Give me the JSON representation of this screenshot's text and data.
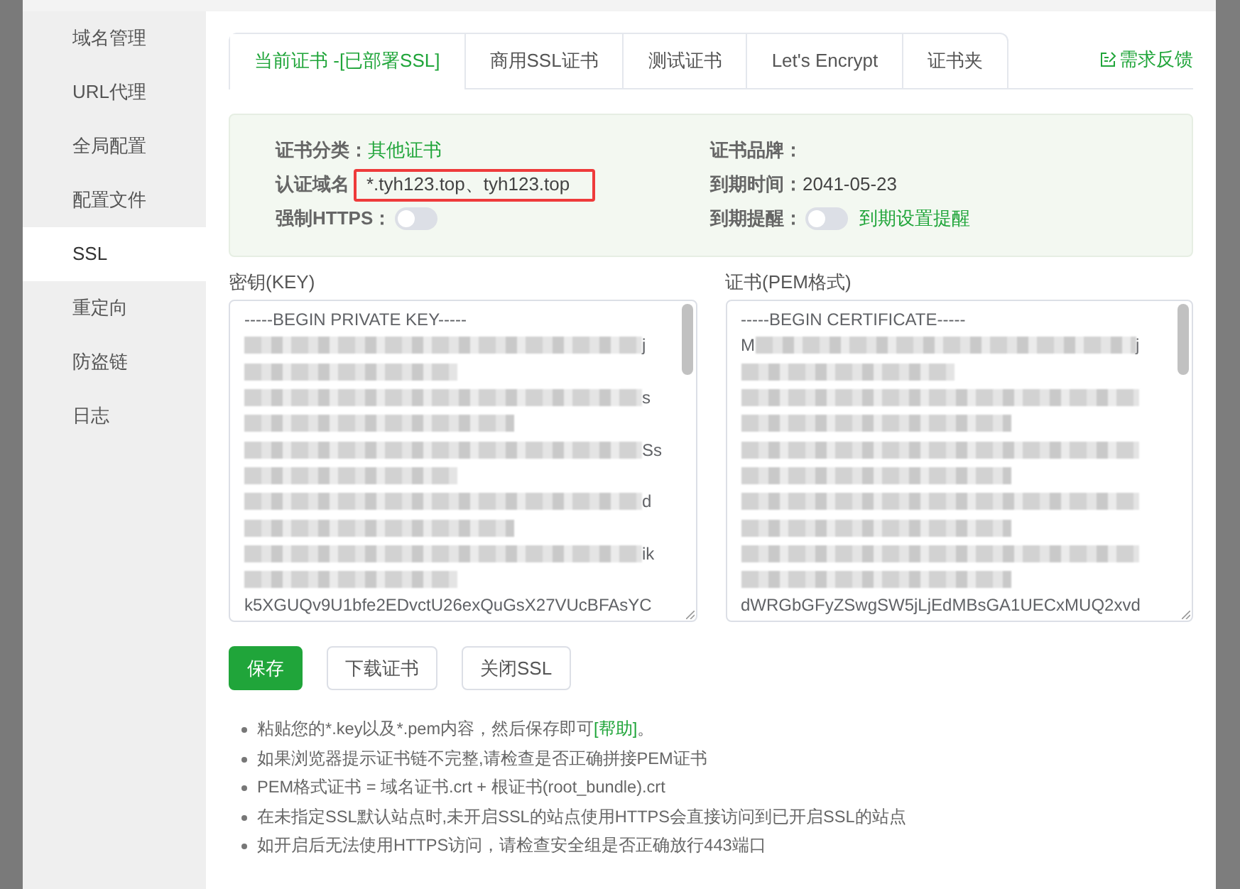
{
  "sidebar": {
    "items": [
      {
        "label": "域名管理",
        "selected": false
      },
      {
        "label": "URL代理",
        "selected": false
      },
      {
        "label": "全局配置",
        "selected": false
      },
      {
        "label": "配置文件",
        "selected": false
      },
      {
        "label": "SSL",
        "selected": true
      },
      {
        "label": "重定向",
        "selected": false
      },
      {
        "label": "防盗链",
        "selected": false
      },
      {
        "label": "日志",
        "selected": false
      }
    ]
  },
  "tabs": [
    {
      "label": "当前证书 -[已部署SSL]",
      "selected": true
    },
    {
      "label": "商用SSL证书",
      "selected": false
    },
    {
      "label": "测试证书",
      "selected": false
    },
    {
      "label": "Let's Encrypt",
      "selected": false
    },
    {
      "label": "证书夹",
      "selected": false
    }
  ],
  "feedback_link": "需求反馈",
  "info": {
    "category": {
      "label": "证书分类：",
      "value": "其他证书"
    },
    "domain": {
      "label": "认证域名",
      "value": "*.tyh123.top、tyh123.top",
      "highlighted": true
    },
    "force_https": {
      "label": "强制HTTPS：",
      "on": false
    },
    "brand": {
      "label": "证书品牌："
    },
    "expiry": {
      "label": "到期时间：",
      "value": "2041-05-23"
    },
    "reminder": {
      "label": "到期提醒：",
      "on": false,
      "link": "到期设置提醒"
    }
  },
  "key_field": {
    "label": "密钥(KEY)",
    "lines": [
      {
        "kind": "text",
        "text": "-----BEGIN PRIVATE KEY-----"
      },
      {
        "kind": "blurred",
        "tail": "j"
      },
      {
        "kind": "blurred-short"
      },
      {
        "kind": "blurred",
        "tail": "s"
      },
      {
        "kind": "blurred-medium"
      },
      {
        "kind": "blurred",
        "tail": "Ss"
      },
      {
        "kind": "blurred-short"
      },
      {
        "kind": "blurred",
        "tail": "d"
      },
      {
        "kind": "blurred-medium"
      },
      {
        "kind": "blurred",
        "tail": "ik"
      },
      {
        "kind": "blurred-short"
      },
      {
        "kind": "text",
        "text": "k5XGUQv9U1bfe2EDvctU26exQuGsX27VUcBFAsYC"
      }
    ]
  },
  "cert_field": {
    "label": "证书(PEM格式)",
    "lines": [
      {
        "kind": "text",
        "text": "-----BEGIN CERTIFICATE-----"
      },
      {
        "kind": "blurred",
        "head": "M",
        "tail": "j"
      },
      {
        "kind": "blurred-short"
      },
      {
        "kind": "blurred"
      },
      {
        "kind": "blurred-medium"
      },
      {
        "kind": "blurred"
      },
      {
        "kind": "blurred-medium"
      },
      {
        "kind": "blurred"
      },
      {
        "kind": "blurred-medium"
      },
      {
        "kind": "blurred"
      },
      {
        "kind": "blurred-medium"
      },
      {
        "kind": "text",
        "text": "dWRGbGFyZSwgSW5jLjEdMBsGA1UECxMUQ2xvd"
      }
    ]
  },
  "buttons": [
    {
      "label": "保存",
      "kind": "primary"
    },
    {
      "label": "下载证书",
      "kind": "default"
    },
    {
      "label": "关闭SSL",
      "kind": "default"
    }
  ],
  "notes": [
    {
      "text": "粘贴您的*.key以及*.pem内容，然后保存即可",
      "link": "[帮助]",
      "suffix": "。"
    },
    {
      "text": "如果浏览器提示证书链不完整,请检查是否正确拼接PEM证书"
    },
    {
      "text": "PEM格式证书 = 域名证书.crt + 根证书(root_bundle).crt"
    },
    {
      "text": "在未指定SSL默认站点时,未开启SSL的站点使用HTTPS会直接访问到已开启SSL的站点"
    },
    {
      "text": "如开启后无法使用HTTPS访问，请检查安全组是否正确放行443端口"
    }
  ]
}
